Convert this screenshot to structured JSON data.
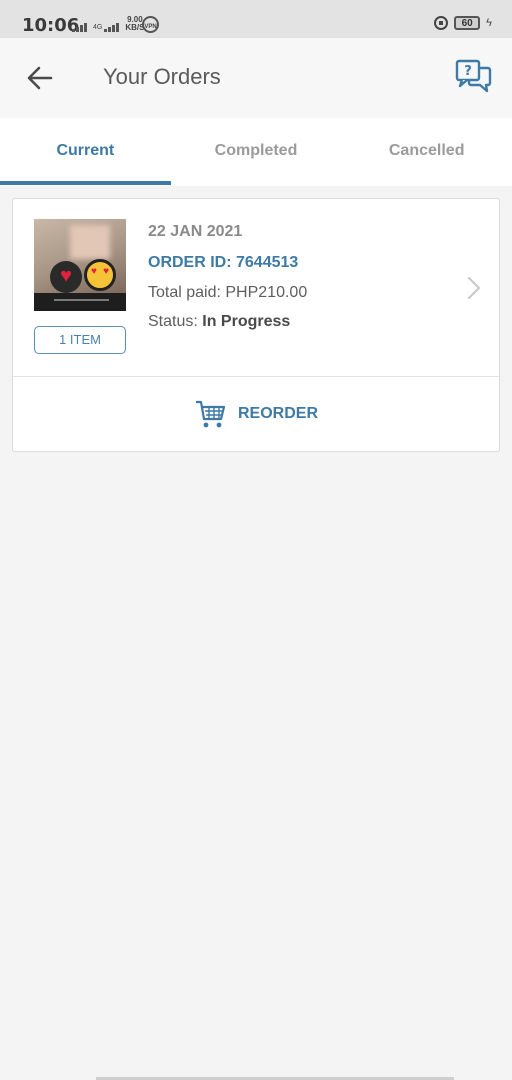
{
  "status_bar": {
    "time": "10:06",
    "network": "4G",
    "speed_value": "9.00",
    "speed_unit": "KB/S",
    "vpn": "VPN",
    "battery": "60"
  },
  "header": {
    "title": "Your Orders",
    "back_icon": "arrow-left-icon",
    "help_icon": "chat-question-icon"
  },
  "tabs": [
    {
      "label": "Current",
      "active": true
    },
    {
      "label": "Completed",
      "active": false
    },
    {
      "label": "Cancelled",
      "active": false
    }
  ],
  "order": {
    "date": "22 JAN 2021",
    "order_id": "ORDER ID: 7644513",
    "total_paid": "Total paid: PHP210.00",
    "status_label": "Status: ",
    "status_value": "In Progress",
    "item_count": "1 ITEM",
    "reorder_label": "REORDER",
    "reorder_icon": "cart-icon"
  },
  "colors": {
    "accent": "#3d7aa6",
    "background": "#f4f4f4"
  }
}
